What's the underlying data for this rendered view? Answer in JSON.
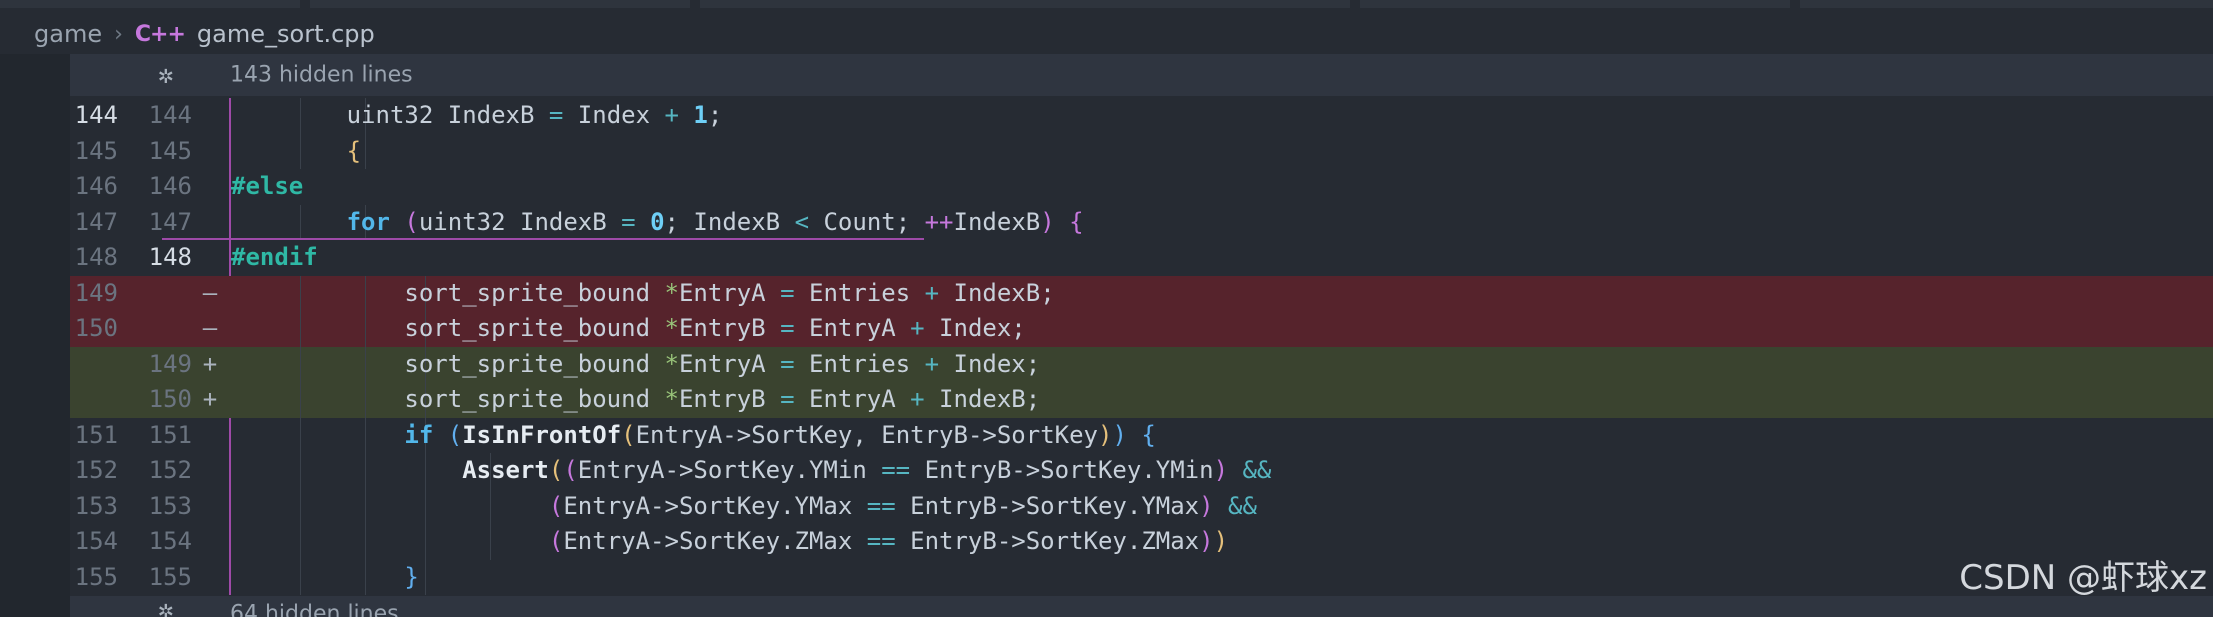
{
  "breadcrumb": {
    "folder": "game",
    "separator": ">",
    "lang_icon": "C++",
    "file": "game_sort.cpp"
  },
  "hidden_top": {
    "icon": "fold-icon",
    "text": "143 hidden lines"
  },
  "hidden_bottom": {
    "icon": "fold-icon",
    "text": "64 hidden lines"
  },
  "lines": [
    {
      "old": "144",
      "new": "144",
      "mark": "",
      "type": "context",
      "old_cur": true,
      "new_cur": false,
      "tokens": [
        [
          "        uint32 IndexB ",
          ""
        ],
        [
          "=",
          "op"
        ],
        [
          " Index ",
          ""
        ],
        [
          "+",
          "op"
        ],
        [
          " ",
          ""
        ],
        [
          "1",
          "num"
        ],
        [
          ";",
          ""
        ]
      ]
    },
    {
      "old": "145",
      "new": "145",
      "mark": "",
      "type": "context",
      "tokens": [
        [
          "        ",
          ""
        ],
        [
          "{",
          "brace-y"
        ]
      ]
    },
    {
      "old": "146",
      "new": "146",
      "mark": "",
      "type": "context",
      "tokens": [
        [
          "#else",
          "pp"
        ]
      ]
    },
    {
      "old": "147",
      "new": "147",
      "mark": "",
      "type": "context",
      "tokens": [
        [
          "        ",
          ""
        ],
        [
          "for",
          "kw"
        ],
        [
          " ",
          ""
        ],
        [
          "(",
          "brace-p"
        ],
        [
          "uint32 IndexB ",
          ""
        ],
        [
          "=",
          "op"
        ],
        [
          " ",
          ""
        ],
        [
          "0",
          "num"
        ],
        [
          "; IndexB ",
          ""
        ],
        [
          "<",
          "op"
        ],
        [
          " Count; ",
          ""
        ],
        [
          "++",
          "opm"
        ],
        [
          "IndexB",
          ""
        ],
        [
          ")",
          "brace-p"
        ],
        [
          " ",
          ""
        ],
        [
          "{",
          "brace-p"
        ]
      ]
    },
    {
      "old": "148",
      "new": "148",
      "mark": "",
      "type": "context",
      "old_cur": false,
      "new_cur": true,
      "tokens": [
        [
          "#endif",
          "pp"
        ]
      ]
    },
    {
      "old": "149",
      "new": "",
      "mark": "—",
      "type": "del",
      "tokens": [
        [
          "            sort_sprite_bound ",
          ""
        ],
        [
          "*",
          "star"
        ],
        [
          "EntryA ",
          ""
        ],
        [
          "=",
          "op"
        ],
        [
          " Entries ",
          ""
        ],
        [
          "+",
          "op"
        ],
        [
          " IndexB;",
          ""
        ]
      ]
    },
    {
      "old": "150",
      "new": "",
      "mark": "—",
      "type": "del",
      "tokens": [
        [
          "            sort_sprite_bound ",
          ""
        ],
        [
          "*",
          "star"
        ],
        [
          "EntryB ",
          ""
        ],
        [
          "=",
          "op"
        ],
        [
          " EntryA ",
          ""
        ],
        [
          "+",
          "op"
        ],
        [
          " Index;",
          ""
        ]
      ]
    },
    {
      "old": "",
      "new": "149",
      "mark": "+",
      "type": "add",
      "tokens": [
        [
          "            sort_sprite_bound ",
          ""
        ],
        [
          "*",
          "star"
        ],
        [
          "EntryA ",
          ""
        ],
        [
          "=",
          "op"
        ],
        [
          " Entries ",
          ""
        ],
        [
          "+",
          "op"
        ],
        [
          " Index;",
          ""
        ]
      ]
    },
    {
      "old": "",
      "new": "150",
      "mark": "+",
      "type": "add",
      "tokens": [
        [
          "            sort_sprite_bound ",
          ""
        ],
        [
          "*",
          "star"
        ],
        [
          "EntryB ",
          ""
        ],
        [
          "=",
          "op"
        ],
        [
          " EntryA ",
          ""
        ],
        [
          "+",
          "op"
        ],
        [
          " IndexB;",
          ""
        ]
      ]
    },
    {
      "old": "151",
      "new": "151",
      "mark": "",
      "type": "context",
      "tokens": [
        [
          "            ",
          ""
        ],
        [
          "if",
          "kw"
        ],
        [
          " ",
          ""
        ],
        [
          "(",
          "brace-b"
        ],
        [
          "IsInFrontOf",
          "fn"
        ],
        [
          "(",
          "brace-y"
        ],
        [
          "EntryA->SortKey, EntryB->SortKey",
          ""
        ],
        [
          ")",
          "brace-y"
        ],
        [
          ")",
          "brace-b"
        ],
        [
          " ",
          ""
        ],
        [
          "{",
          "brace-b"
        ]
      ]
    },
    {
      "old": "152",
      "new": "152",
      "mark": "",
      "type": "context",
      "tokens": [
        [
          "                ",
          ""
        ],
        [
          "Assert",
          "fn"
        ],
        [
          "(",
          "brace-y"
        ],
        [
          "(",
          "brace-p"
        ],
        [
          "EntryA->SortKey.YMin ",
          ""
        ],
        [
          "==",
          "op"
        ],
        [
          " EntryB->SortKey.YMin",
          ""
        ],
        [
          ")",
          "brace-p"
        ],
        [
          " ",
          ""
        ],
        [
          "&&",
          "op"
        ]
      ]
    },
    {
      "old": "153",
      "new": "153",
      "mark": "",
      "type": "context",
      "tokens": [
        [
          "                      ",
          ""
        ],
        [
          "(",
          "brace-p"
        ],
        [
          "EntryA->SortKey.YMax ",
          ""
        ],
        [
          "==",
          "op"
        ],
        [
          " EntryB->SortKey.YMax",
          ""
        ],
        [
          ")",
          "brace-p"
        ],
        [
          " ",
          ""
        ],
        [
          "&&",
          "op"
        ]
      ]
    },
    {
      "old": "154",
      "new": "154",
      "mark": "",
      "type": "context",
      "tokens": [
        [
          "                      ",
          ""
        ],
        [
          "(",
          "brace-p"
        ],
        [
          "EntryA->SortKey.ZMax ",
          ""
        ],
        [
          "==",
          "op"
        ],
        [
          " EntryB->SortKey.ZMax",
          ""
        ],
        [
          ")",
          "brace-p"
        ],
        [
          ")",
          "brace-y"
        ]
      ]
    },
    {
      "old": "155",
      "new": "155",
      "mark": "",
      "type": "context",
      "tokens": [
        [
          "            ",
          ""
        ],
        [
          "}",
          "brace-b"
        ]
      ]
    }
  ],
  "watermark": "CSDN @虾球xz"
}
